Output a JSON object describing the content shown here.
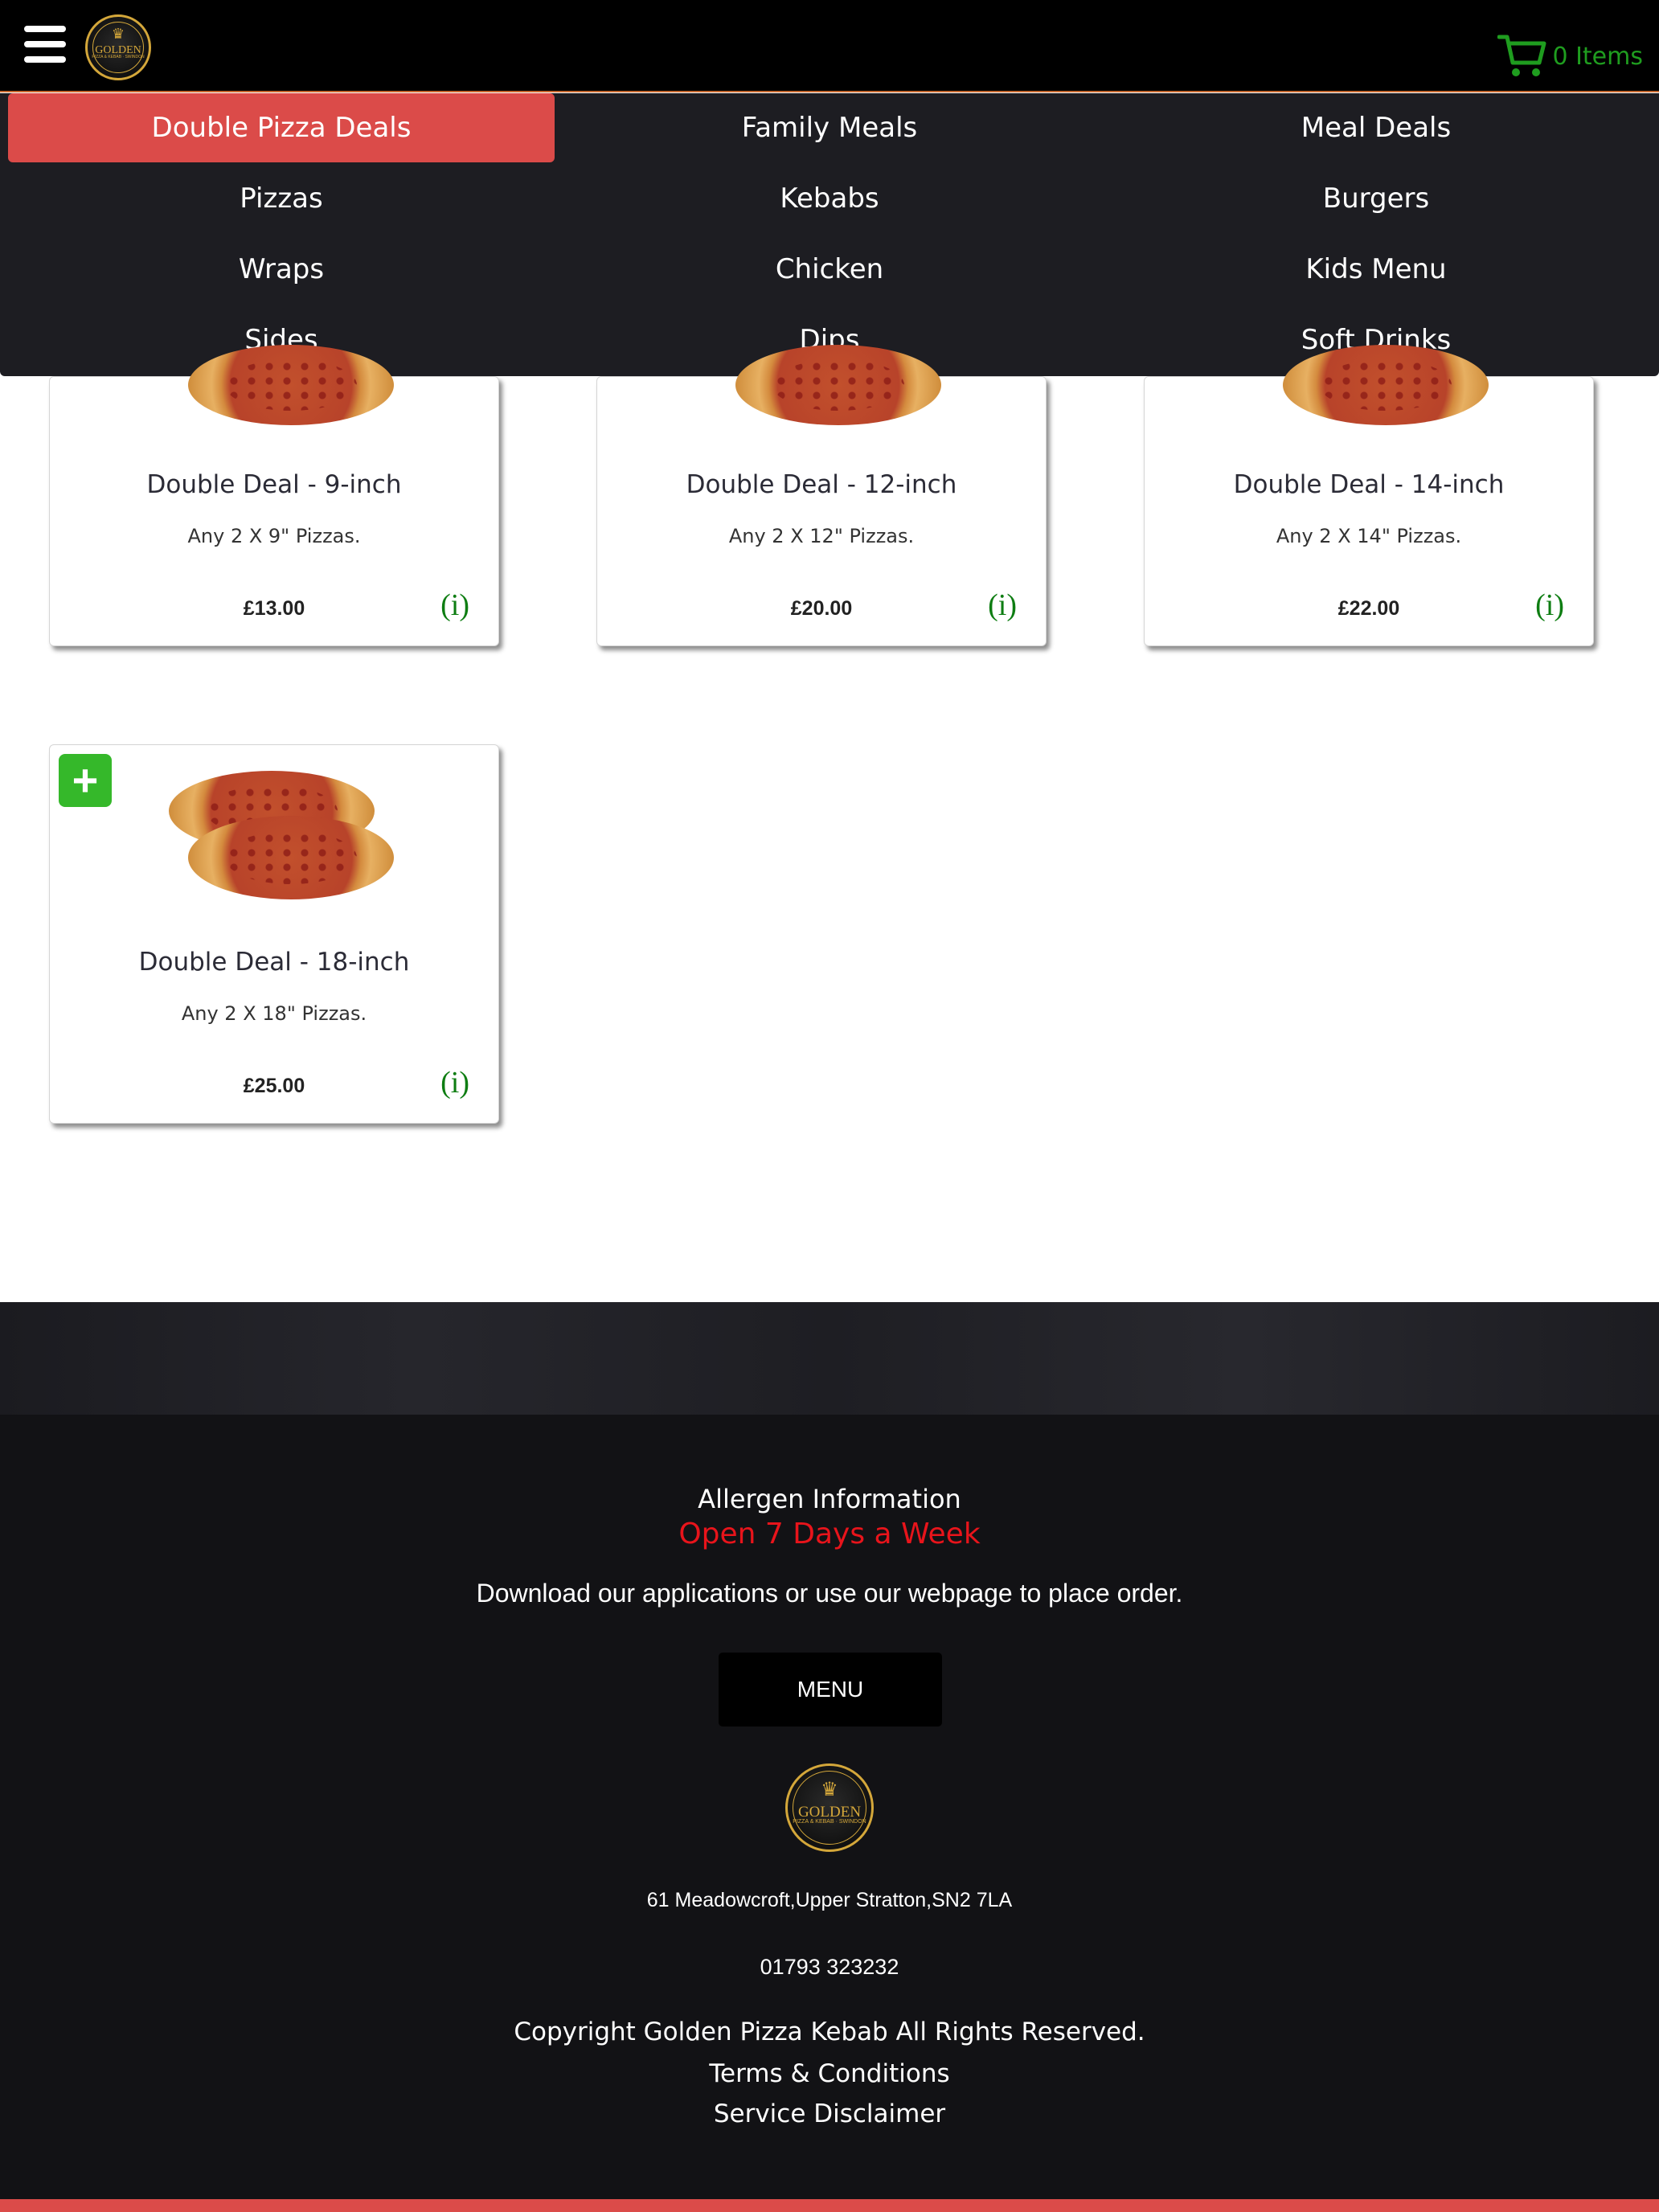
{
  "header": {
    "menu_icon": "hamburger-icon",
    "logo": {
      "name": "Golden Pizza & Kebab logo",
      "word": "GOLDEN",
      "sub": "PIZZA & KEBAB · SWINDON"
    },
    "cart": {
      "icon": "shopping-cart-icon",
      "label": "0 Items",
      "color": "#1f9d1f"
    }
  },
  "categories": {
    "active_color": "#db4b49",
    "items": [
      {
        "label": "Double Pizza Deals",
        "active": true
      },
      {
        "label": "Family Meals",
        "active": false
      },
      {
        "label": "Meal Deals",
        "active": false
      },
      {
        "label": "Pizzas",
        "active": false
      },
      {
        "label": "Kebabs",
        "active": false
      },
      {
        "label": "Burgers",
        "active": false
      },
      {
        "label": "Wraps",
        "active": false
      },
      {
        "label": "Chicken",
        "active": false
      },
      {
        "label": "Kids Menu",
        "active": false
      },
      {
        "label": "Sides",
        "active": false
      },
      {
        "label": "Dips",
        "active": false
      },
      {
        "label": "Soft Drinks",
        "active": false
      }
    ]
  },
  "products": [
    {
      "title": "Double Deal - 9-inch",
      "description": "Any 2 X 9\" Pizzas.",
      "price": "£13.00",
      "info": "(i)"
    },
    {
      "title": "Double Deal - 12-inch",
      "description": "Any 2 X 12\" Pizzas.",
      "price": "£20.00",
      "info": "(i)"
    },
    {
      "title": "Double Deal - 14-inch",
      "description": "Any 2 X 14\" Pizzas.",
      "price": "£22.00",
      "info": "(i)"
    },
    {
      "title": "Double Deal - 18-inch",
      "description": "Any 2 X 18\" Pizzas.",
      "price": "£25.00",
      "info": "(i)",
      "add_label": "+"
    }
  ],
  "footer": {
    "allergen": "Allergen Information",
    "open": "Open 7 Days a Week",
    "open_color": "#e8141b",
    "download": "Download our applications or use our webpage to place order.",
    "menu_button": "MENU",
    "logo": {
      "word": "GOLDEN",
      "sub": "PIZZA & KEBAB · SWINDON"
    },
    "address": "61 Meadowcroft,Upper Stratton,SN2 7LA",
    "phone": "01793 323232",
    "copyright": "Copyright Golden Pizza Kebab All Rights Reserved.",
    "terms": "Terms & Conditions",
    "disclaimer": "Service Disclaimer"
  }
}
